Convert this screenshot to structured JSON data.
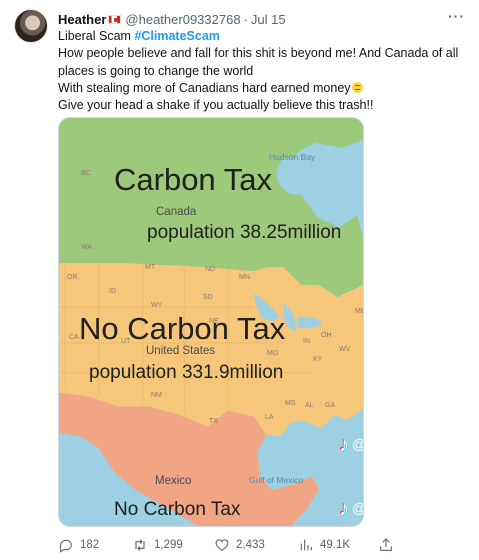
{
  "author": {
    "display_name": "Heather",
    "flag_icon": "canada-flag-icon",
    "handle": "@heather09332768",
    "separator": "·",
    "date": "Jul 15"
  },
  "more_icon": "more-horizontal-icon",
  "tweet": {
    "line1_text": "Liberal Scam ",
    "line1_hashtag": "#ClimateScam",
    "line2": "How people believe and fall for this shit is beyond me! And Canada of all",
    "line3": "places is going to change the world",
    "line4": "With stealing more of Canadians hard earned money",
    "line4_emoji": "grimace-emoji-icon",
    "line5": "Give your head a shake if you actually believe this trash!!"
  },
  "media": {
    "title_canada": "Carbon Tax",
    "canada_label": "Canada",
    "canada_population": "population 38.25million",
    "title_us": "No Carbon Tax",
    "us_label": "United States",
    "us_population": "population 331.9million",
    "mexico_label": "Mexico",
    "mexico_tax": "No Carbon Tax",
    "hudson_bay": "Hudson Bay",
    "gulf_of_mexico": "Gulf of Mexico",
    "bc": "BC",
    "mt": "MT",
    "nd": "ND",
    "mn": "MN",
    "or": "OR",
    "id": "ID",
    "sd": "SD",
    "wy": "WY",
    "ut": "UT",
    "ne": "NE",
    "in": "IN",
    "oh": "OH",
    "wv": "WV",
    "mo": "MO",
    "ky": "KY",
    "nm": "NM",
    "ms": "MS",
    "al": "AL",
    "ga": "GA",
    "tx": "TX",
    "la": "LA",
    "ca": "CA",
    "wa": "WA",
    "me": "ME",
    "watermark_at": "@",
    "colors": {
      "canada": "#9dc97b",
      "usa": "#f6c77a",
      "mexico": "#f2a585",
      "water": "#9cd0e2",
      "hashtag": "#1d9bf0"
    }
  },
  "actions": {
    "reply": {
      "icon": "reply-icon",
      "count": "182"
    },
    "retweet": {
      "icon": "retweet-icon",
      "count": "1,299"
    },
    "like": {
      "icon": "heart-icon",
      "count": "2,433"
    },
    "views": {
      "icon": "views-chart-icon",
      "count": "49.1K"
    },
    "share": {
      "icon": "share-icon"
    }
  }
}
